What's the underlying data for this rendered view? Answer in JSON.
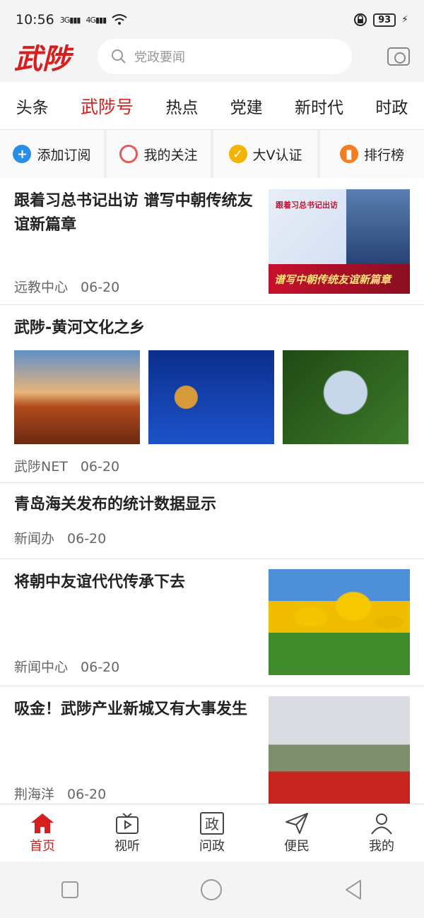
{
  "status": {
    "time": "10:56",
    "net1": "3G",
    "net2": "4G",
    "battery": "93"
  },
  "header": {
    "logo": "武陟",
    "search_placeholder": "党政要闻"
  },
  "tabs": [
    {
      "label": "头条"
    },
    {
      "label": "武陟号"
    },
    {
      "label": "热点"
    },
    {
      "label": "党建"
    },
    {
      "label": "新时代"
    },
    {
      "label": "时政"
    }
  ],
  "quick": [
    {
      "label": "添加订阅",
      "icon": "plus-circle-icon",
      "color": "#2a8ee8"
    },
    {
      "label": "我的关注",
      "icon": "circle-outline-icon",
      "color": "#e25a5a"
    },
    {
      "label": "大V认证",
      "icon": "v-badge-icon",
      "color": "#f3b300"
    },
    {
      "label": "排行榜",
      "icon": "bar-chart-icon",
      "color": "#f47d1f"
    }
  ],
  "articles": [
    {
      "title": "跟着习总书记出访 谱写中朝传统友谊新篇章",
      "source": "远教中心",
      "date": "06-20",
      "thumb_text": "跟着习总书记出访",
      "thumb_slogan": "谱写中朝传统友谊新篇章"
    },
    {
      "title": "武陟-黄河文化之乡",
      "source": "武陟NET",
      "date": "06-20"
    },
    {
      "title": "青岛海关发布的统计数据显示",
      "source": "新闻办",
      "date": "06-20"
    },
    {
      "title": "将朝中友谊代代传承下去",
      "source": "新闻中心",
      "date": "06-20"
    },
    {
      "title": "吸金！武陟产业新城又有大事发生",
      "source": "荆海洋",
      "date": "06-20"
    }
  ],
  "bottom_nav": [
    {
      "label": "首页",
      "icon": "home-icon"
    },
    {
      "label": "视听",
      "icon": "tv-icon"
    },
    {
      "label": "问政",
      "icon": "zheng-icon",
      "glyph": "政"
    },
    {
      "label": "便民",
      "icon": "send-icon"
    },
    {
      "label": "我的",
      "icon": "user-icon"
    }
  ],
  "colors": {
    "accent": "#d61f1f"
  }
}
